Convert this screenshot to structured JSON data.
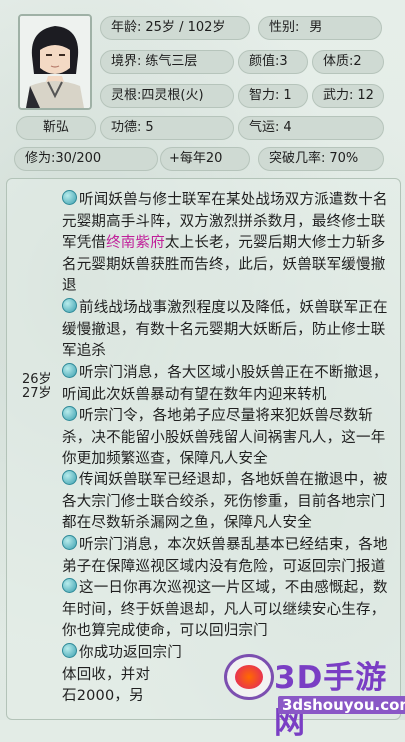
{
  "character": {
    "name": "靳弘",
    "age_label": "年龄:",
    "age_value": "25岁 / 102岁",
    "gender_label": "性别:",
    "gender_value": "男",
    "realm_label": "境界:",
    "realm_value": "练气三层",
    "looks_label": "颜值:",
    "looks_value": "3",
    "physique_label": "体质:",
    "physique_value": "2",
    "root_label": "灵根:",
    "root_value": "四灵根(火)",
    "intellect_label": "智力:",
    "intellect_value": "1",
    "force_label": "武力:",
    "force_value": "12",
    "merit_label": "功德:",
    "merit_value": "5",
    "luck_label": "气运:",
    "luck_value": "4",
    "cultivation_label": "修为:",
    "cultivation_value": "30/200",
    "per_year": "+每年20",
    "breakthrough_label": "突破几率:",
    "breakthrough_value": "70%"
  },
  "log": {
    "ages": [
      "26岁",
      "27岁"
    ],
    "entries": [
      {
        "pre": "听闻妖兽与修士联军在某处战场双方派遣数十名元婴期高手斗阵，双方激烈拼杀数月，最终修士联军凭借",
        "hl": "终南紫府",
        "post": "太上长老，元婴后期大修士力斩多名元婴期妖兽获胜而告终，此后，妖兽联军缓慢撤退"
      },
      {
        "pre": "前线战场战事激烈程度以及降低，妖兽联军正在缓慢撤退，有数十名元婴期大妖断后，防止修士联军追杀"
      },
      {
        "pre": "听宗门消息，各大区域小股妖兽正在不断撤退，听闻此次妖兽暴动有望在数年内迎来转机"
      },
      {
        "pre": "听宗门令，各地弟子应尽量将来犯妖兽尽数斩杀，决不能留小股妖兽残留人间祸害凡人，这一年你更加频繁巡查，保障凡人安全"
      },
      {
        "pre": "传闻妖兽联军已经退却，各地妖兽在撤退中，被各大宗门修士联合绞杀，死伤惨重，目前各地宗门都在尽数斩杀漏网之鱼，保障凡人安全"
      },
      {
        "pre": "听宗门消息，本次妖兽暴乱基本已经结束，各地弟子在保障巡视区域内没有危险，可返回宗门报道"
      },
      {
        "pre": "这一日你再次巡视这一片区域，不由感慨起，数年时间，终于妖兽退却，凡人可以继续安心生存，你也算完成使命，可以回归宗门"
      },
      {
        "pre": "你成功返回宗门",
        "post2": "体回收，并对",
        "post3": "石2000，另"
      }
    ]
  },
  "watermark": {
    "title": "3D手游网",
    "url": "3dshouyou.com"
  },
  "colors": {
    "highlight": "#c0209a",
    "pill_bg": "#cfdad3"
  }
}
